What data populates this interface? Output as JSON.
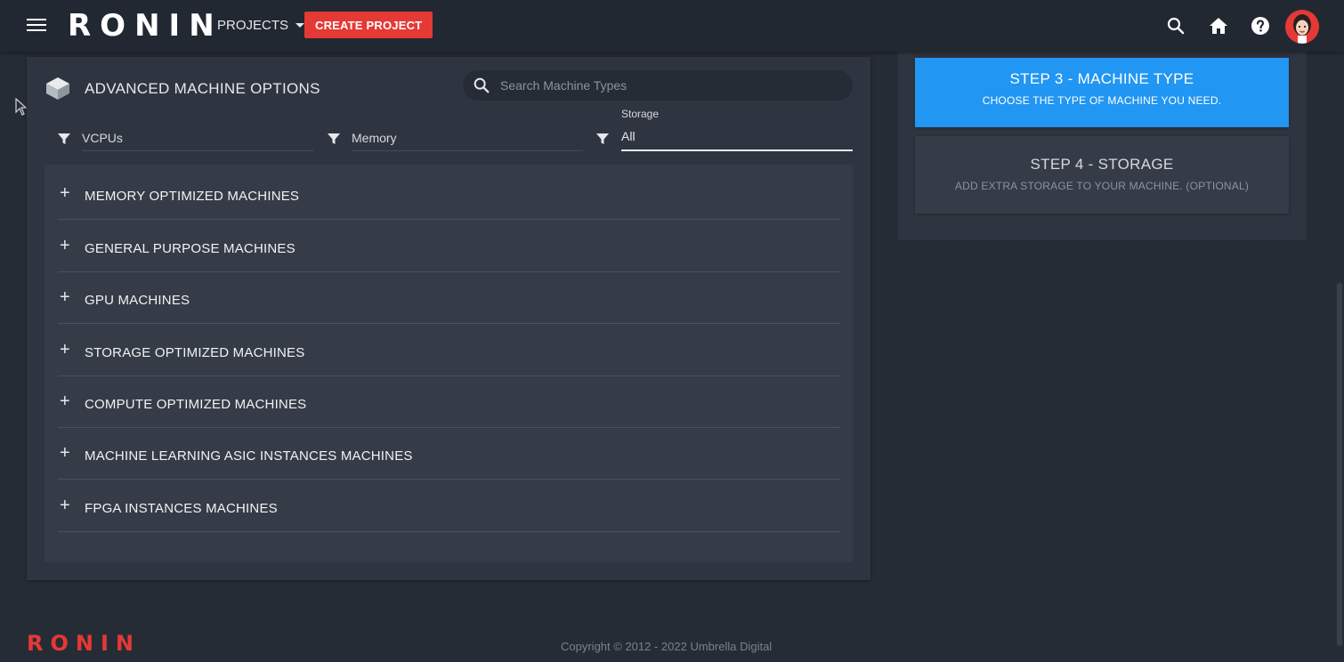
{
  "header": {
    "logo": "RONIN",
    "projects_label": "PROJECTS",
    "create_label": "CREATE PROJECT",
    "icons": [
      "menu-icon",
      "search-icon",
      "home-icon",
      "help-icon",
      "avatar"
    ]
  },
  "main": {
    "title": "ADVANCED MACHINE OPTIONS",
    "search_placeholder": "Search Machine Types",
    "filters": {
      "vcpus": "VCPUs",
      "memory": "Memory",
      "storage_label": "Storage",
      "storage_value": "All"
    },
    "categories": [
      "MEMORY OPTIMIZED MACHINES",
      "GENERAL PURPOSE MACHINES",
      "GPU MACHINES",
      "STORAGE OPTIMIZED MACHINES",
      "COMPUTE OPTIMIZED MACHINES",
      "MACHINE LEARNING ASIC INSTANCES MACHINES",
      "FPGA INSTANCES MACHINES"
    ],
    "expand_symbol": "+"
  },
  "steps": [
    {
      "title": "STEP 3 - MACHINE TYPE",
      "subtitle": "CHOOSE THE TYPE OF MACHINE YOU NEED.",
      "active": true
    },
    {
      "title": "STEP 4 - STORAGE",
      "subtitle": "ADD EXTRA STORAGE TO YOUR MACHINE. (OPTIONAL)",
      "active": false
    }
  ],
  "footer": {
    "logo": "RONIN",
    "copyright": "Copyright © 2012 - 2022 Umbrella Digital"
  },
  "colors": {
    "accent_red": "#e53935",
    "active_step_blue": "#2196f3",
    "background": "#262c36"
  }
}
